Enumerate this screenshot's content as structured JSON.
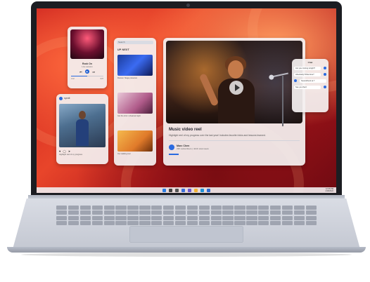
{
  "music": {
    "song_title": "Rock On",
    "artist": "Live session",
    "time_start": "1:42",
    "time_end": "3:27",
    "progress": 0.5
  },
  "social": {
    "account": "sprott",
    "caption": "Highlight reel of my progress"
  },
  "upnext": {
    "search_placeholder": "Search",
    "heading": "UP NEXT",
    "items": [
      {
        "caption": "Review: Stage presence"
      },
      {
        "caption": "Get the shot: rehearsal night"
      },
      {
        "caption": "Our walking tour"
      }
    ]
  },
  "video": {
    "title": "Music video reel",
    "description": "Highlight reel of my progress over the last year! Includes favorite tricks and lessons learned.",
    "channel_name": "Marc Chen",
    "channel_stats": "23K subscribers | 421K total views"
  },
  "chat": {
    "title": "Chat",
    "messages": [
      "Are you coming tonight?",
      "Absolutely! What time?",
      "Soundcheck at 7",
      "See you then!"
    ]
  },
  "taskbar": {
    "time": "12:35 PM",
    "date": "2/18/2022"
  }
}
